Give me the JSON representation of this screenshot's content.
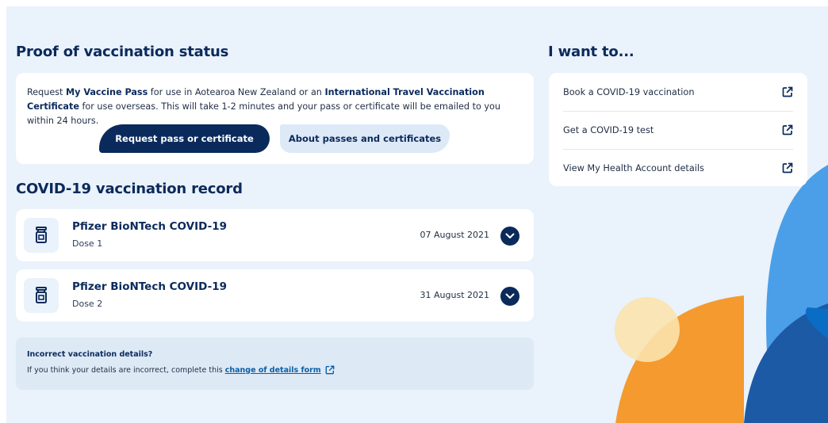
{
  "proof": {
    "heading": "Proof of vaccination status",
    "intro_1": "Request ",
    "intro_pass": "My Vaccine Pass",
    "intro_2": " for use in Aotearoa New Zealand or an ",
    "intro_cert": "International Travel Vaccination Certificate",
    "intro_3": " for use overseas. This will take 1-2 minutes and your pass or certificate will be emailed to you within 24 hours.",
    "request_button": "Request pass or certificate",
    "about_button": "About passes and certificates"
  },
  "record": {
    "heading": "COVID-19 vaccination record",
    "items": [
      {
        "name": "Pfizer BioNTech COVID-19",
        "dose": "Dose 1",
        "date": "07 August 2021",
        "icon": "vial-icon"
      },
      {
        "name": "Pfizer BioNTech COVID-19",
        "dose": "Dose 2",
        "date": "31 August 2021",
        "icon": "vial-icon"
      }
    ]
  },
  "notice": {
    "title": "Incorrect vaccination details?",
    "text": "If you think your details are incorrect, complete this",
    "link": "change of details form"
  },
  "sidebar": {
    "heading": "I want to...",
    "links": [
      {
        "label": "Book a COVID-19 vaccination",
        "icon": "external-link-icon"
      },
      {
        "label": "Get a COVID-19 test",
        "icon": "external-link-icon"
      },
      {
        "label": "View My Health Account details",
        "icon": "external-link-icon"
      }
    ]
  },
  "colors": {
    "navy": "#0b2a5c",
    "page_bg": "#eaf2fb",
    "accent_blue": "#4b9fe8",
    "accent_orange": "#f59a2e",
    "accent_yellow": "#fbe3ad"
  }
}
